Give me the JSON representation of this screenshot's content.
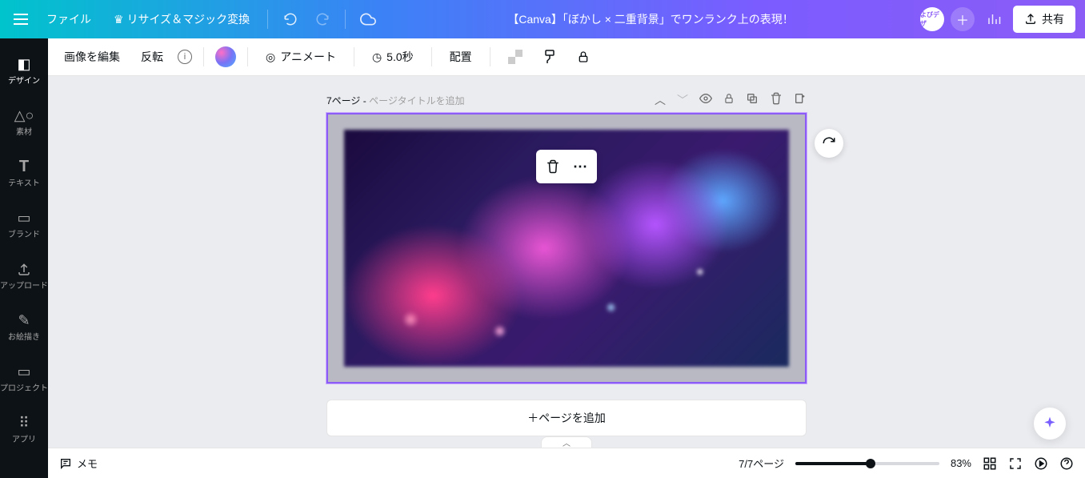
{
  "topbar": {
    "file": "ファイル",
    "resize": "リサイズ＆マジック変換",
    "title": "【Canva】「ぼかし × 二重背景」でワンランク上の表現！",
    "share": "共有",
    "avatar": "よびデザ"
  },
  "sidebar": {
    "items": [
      {
        "label": "デザイン"
      },
      {
        "label": "素材"
      },
      {
        "label": "テキスト"
      },
      {
        "label": "ブランド"
      },
      {
        "label": "アップロード"
      },
      {
        "label": "お絵描き"
      },
      {
        "label": "プロジェクト"
      },
      {
        "label": "アプリ"
      }
    ]
  },
  "toolbar2": {
    "edit_image": "画像を編集",
    "flip": "反転",
    "animate": "アニメート",
    "duration": "5.0秒",
    "position": "配置"
  },
  "page": {
    "number": "7ページ",
    "sep": " - ",
    "placeholder": "ページタイトルを追加",
    "add_page": "＋ページを追加"
  },
  "bottombar": {
    "notes": "メモ",
    "pages": "7/7ページ",
    "zoom": "83%"
  }
}
